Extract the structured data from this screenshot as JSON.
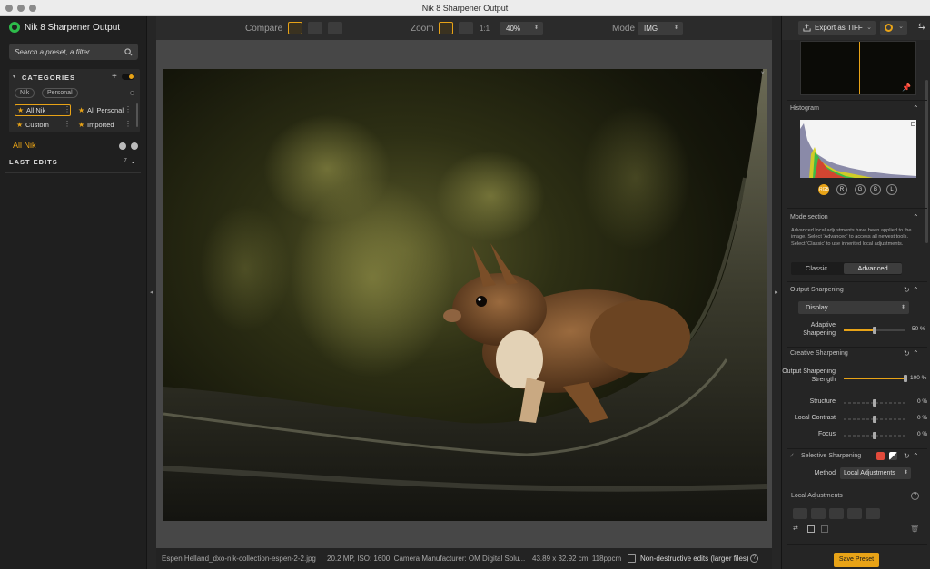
{
  "window": {
    "title": "Nik 8 Sharpener Output"
  },
  "app": {
    "name": "Nik 8 Sharpener Output"
  },
  "search": {
    "placeholder": "Search a preset, a filter..."
  },
  "categories": {
    "header": "CATEGORIES",
    "pills": [
      "Nik",
      "Personal"
    ],
    "presets": [
      "All Nik",
      "All Personal",
      "Custom",
      "Imported"
    ],
    "selected": "All Nik"
  },
  "last_edits": {
    "label": "LAST EDITS",
    "count": "7"
  },
  "toolbar": {
    "compare_label": "Compare",
    "zoom_label": "Zoom",
    "zoom_one": "1:1",
    "zoom_value": "40%",
    "mode_label": "Mode",
    "mode_value": "IMG"
  },
  "status_bar": {
    "filename": "Espen Helland_dxo-nik-collection-espen-2-2.jpg",
    "meta": "20.2 MP, ISO: 1600, Camera Manufacturer: OM Digital Solu...",
    "dims": "43.89 x 32.92 cm, 118ppcm",
    "nondestructive": "Non-destructive edits (larger files)"
  },
  "right": {
    "export_label": "Export as TIFF",
    "histogram_title": "Histogram",
    "channels": [
      "RGB",
      "R",
      "G",
      "B",
      "L"
    ],
    "mode_section_title": "Mode section",
    "mode_section_text": "Advanced local adjustments have been applied to the image. Select 'Advanced' to access all newest tools. Select 'Classic' to use inherited local adjustments.",
    "mode_classic": "Classic",
    "mode_advanced": "Advanced",
    "output_sharpening_title": "Output Sharpening",
    "output_type": "Display",
    "adaptive_label": "Adaptive Sharpening",
    "adaptive_value": "50 %",
    "adaptive_level": 0.5,
    "creative_title": "Creative Sharpening",
    "oss_label": "Output Sharpening Strength",
    "oss_value": "100 %",
    "oss_level": 1.0,
    "structure_label": "Structure",
    "structure_value": "0 %",
    "local_contrast_label": "Local Contrast",
    "local_contrast_value": "0 %",
    "focus_label": "Focus",
    "focus_value": "0 %",
    "selective_label": "Selective Sharpening",
    "method_label": "Method",
    "method_value": "Local Adjustments",
    "local_adj_title": "Local Adjustments",
    "save_preset": "Save Preset"
  },
  "colors": {
    "accent": "#e8a317",
    "selective_swatch": "#e24a3b"
  }
}
